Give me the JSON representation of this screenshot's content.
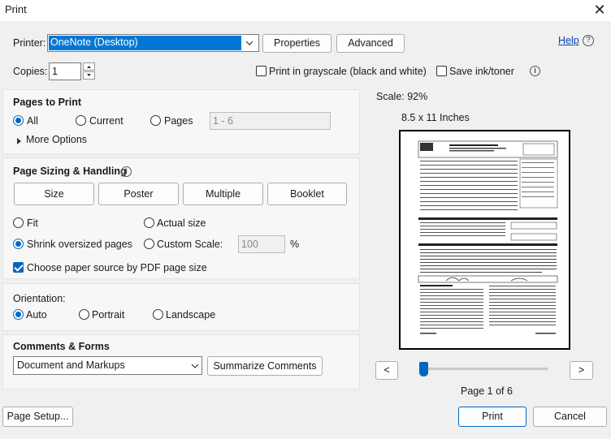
{
  "window": {
    "title": "Print",
    "close_glyph": "✕"
  },
  "printer": {
    "label": "Printer:",
    "selected": "OneNote (Desktop)",
    "properties_button": "Properties",
    "advanced_button": "Advanced",
    "help_link": "Help",
    "help_icon": "?"
  },
  "copies": {
    "label": "Copies:",
    "value": "1"
  },
  "options": {
    "grayscale_label": "Print in grayscale (black and white)",
    "grayscale_checked": false,
    "save_ink_label": "Save ink/toner",
    "save_ink_checked": false
  },
  "pages_to_print": {
    "heading": "Pages to Print",
    "all_label": "All",
    "current_label": "Current",
    "pages_label": "Pages",
    "pages_range": "1 - 6",
    "more_options": "More Options",
    "selected": "All"
  },
  "page_sizing": {
    "heading": "Page Sizing & Handling",
    "size_button": "Size",
    "poster_button": "Poster",
    "multiple_button": "Multiple",
    "booklet_button": "Booklet",
    "fit_label": "Fit",
    "actual_size_label": "Actual size",
    "shrink_label": "Shrink oversized pages",
    "custom_scale_label": "Custom Scale:",
    "custom_scale_value": "100",
    "percent": "%",
    "selected": "Shrink oversized pages",
    "paper_source_label": "Choose paper source by PDF page size",
    "paper_source_checked": true
  },
  "orientation": {
    "heading": "Orientation:",
    "auto_label": "Auto",
    "portrait_label": "Portrait",
    "landscape_label": "Landscape",
    "selected": "Auto"
  },
  "comments_forms": {
    "heading": "Comments & Forms",
    "selected": "Document and Markups",
    "summarize_button": "Summarize Comments"
  },
  "preview": {
    "scale_text": "Scale:  92%",
    "paper_size": "8.5 x 11 Inches",
    "prev_button": "<",
    "next_button": ">",
    "page_indicator": "Page 1 of 6",
    "slider_position": 0
  },
  "footer": {
    "page_setup_button": "Page Setup...",
    "print_button": "Print",
    "cancel_button": "Cancel"
  },
  "colors": {
    "accent": "#0067c0",
    "selection": "#0078d7"
  }
}
